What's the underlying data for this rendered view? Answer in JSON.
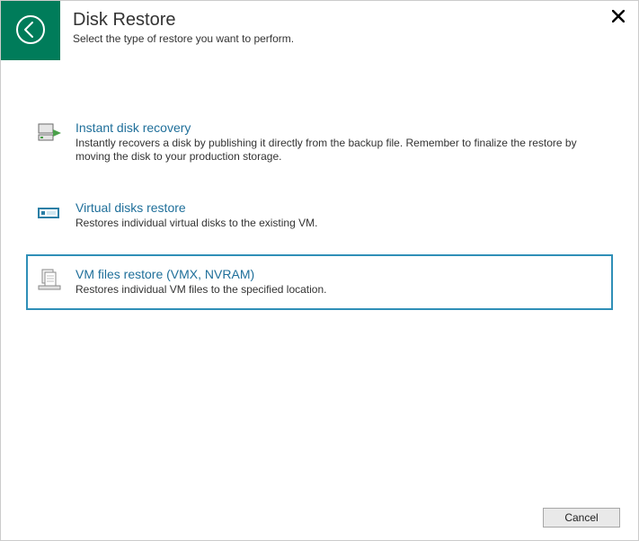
{
  "header": {
    "title": "Disk Restore",
    "subtitle": "Select the type of restore you want to perform."
  },
  "options": [
    {
      "title": "Instant disk recovery",
      "desc": "Instantly recovers a disk by publishing it directly from the backup file. Remember to finalize the restore by moving the disk to your production storage."
    },
    {
      "title": "Virtual disks restore",
      "desc": "Restores individual virtual disks to the existing VM."
    },
    {
      "title": "VM files restore (VMX, NVRAM)",
      "desc": "Restores individual VM files to the specified location."
    }
  ],
  "buttons": {
    "cancel": "Cancel"
  },
  "colors": {
    "accent": "#007c5a",
    "link": "#1f6f9a",
    "select": "#2f8fb7"
  }
}
